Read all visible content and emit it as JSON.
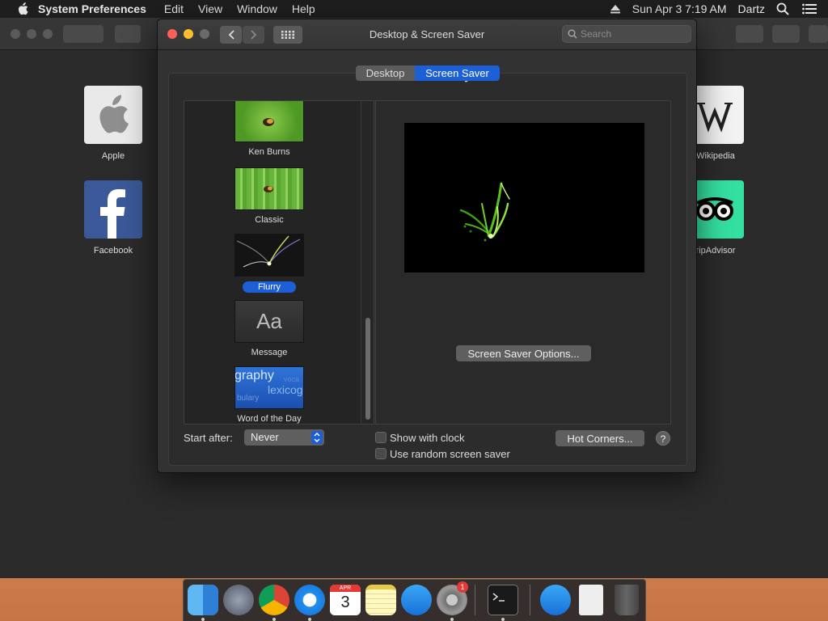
{
  "menubar": {
    "app_name": "System Preferences",
    "items": [
      "Edit",
      "View",
      "Window",
      "Help"
    ],
    "datetime": "Sun Apr 3  7:19 AM",
    "user": "Dartz"
  },
  "safari": {
    "favorites": [
      {
        "label": "Apple"
      },
      {
        "label": "Facebook"
      },
      {
        "label": "Wikipedia"
      },
      {
        "label": "ripAdvisor"
      }
    ]
  },
  "window": {
    "title": "Desktop & Screen Saver",
    "search_placeholder": "Search",
    "tabs": [
      {
        "label": "Desktop",
        "selected": false
      },
      {
        "label": "Screen Saver",
        "selected": true
      }
    ],
    "screensavers": [
      {
        "label": "Ken Burns",
        "selected": false
      },
      {
        "label": "Classic",
        "selected": false
      },
      {
        "label": "Flurry",
        "selected": true
      },
      {
        "label": "Message",
        "selected": false,
        "thumb_text": "Aa"
      },
      {
        "label": "Word of the Day",
        "selected": false,
        "thumb_words": [
          "graphy",
          "lexicog",
          "bulary",
          "voca"
        ]
      }
    ],
    "options_button": "Screen Saver Options...",
    "start_after_label": "Start after:",
    "start_after_value": "Never",
    "show_with_clock": {
      "label": "Show with clock",
      "checked": false
    },
    "use_random": {
      "label": "Use random screen saver",
      "checked": false
    },
    "hot_corners_button": "Hot Corners...",
    "help_label": "?"
  },
  "dock": {
    "calendar_month": "APR",
    "calendar_day": "3",
    "badge_count": "1"
  },
  "colors": {
    "accent": "#1c5fd6",
    "window_bg": "#323233"
  }
}
